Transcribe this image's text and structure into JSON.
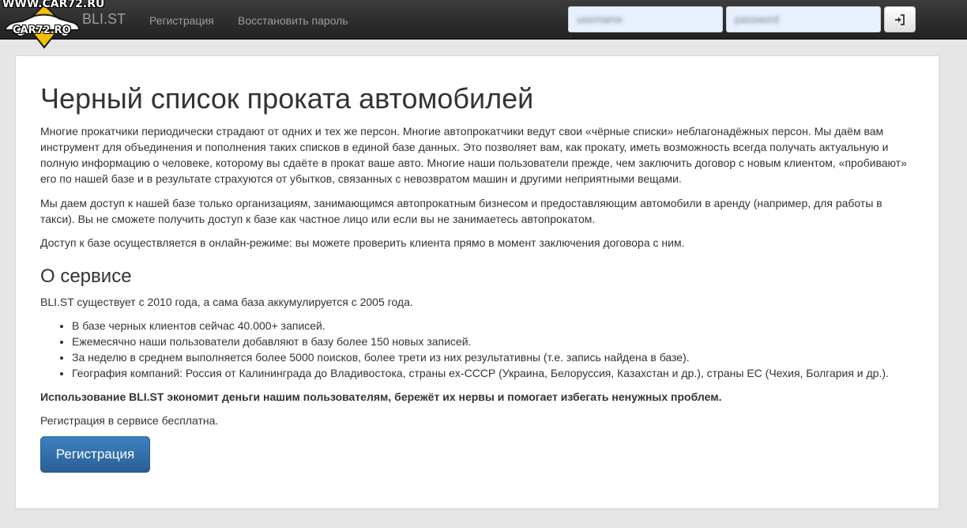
{
  "watermark": {
    "site": "WWW.CAR72.RU",
    "logo_text": "CAR72.RO"
  },
  "navbar": {
    "brand": "BLI.ST",
    "links": [
      {
        "label": "Регистрация"
      },
      {
        "label": "Восстановить пароль"
      }
    ],
    "login": {
      "email_value": "username",
      "password_value": "password",
      "submit_icon": "sign-in-icon"
    }
  },
  "main": {
    "title": "Черный список проката автомобилей",
    "intro_paragraphs": [
      "Многие прокатчики периодически страдают от одних и тех же персон. Многие автопрокатчики ведут свои «чёрные списки» неблагонадёжных персон. Мы даём вам инструмент для объединения и пополнения таких списков в единой базе данных. Это позволяет вам, как прокату, иметь возможность всегда получать актуальную и полную информацию о человеке, которому вы сдаёте в прокат ваше авто. Многие наши пользователи прежде, чем заключить договор с новым клиентом, «пробивают» его по нашей базе и в результате страхуются от убытков, связанных с невозвратом машин и другими неприятными вещами.",
      "Мы даем доступ к нашей базе только организациям, занимающимся автопрокатным бизнесом и предоставляющим автомобили в аренду (например, для работы в такси). Вы не сможете получить доступ к базе как частное лицо или если вы не занимаетесь автопрокатом.",
      "Доступ к базе осуществляется в онлайн-режиме: вы можете проверить клиента прямо в момент заключения договора с ним."
    ],
    "about": {
      "heading": "О сервисе",
      "intro": "BLI.ST существует с 2010 года, а сама база аккумулируется с 2005 года.",
      "features": [
        "В базе черных клиентов сейчас 40.000+ записей.",
        "Ежемесячно наши пользователи добавляют в базу более 150 новых записей.",
        "За неделю в среднем выполняется более 5000 поисков, более трети из них результативны (т.е. запись найдена в базе).",
        "География компаний: Россия от Калининграда до Владивостока, страны ex-СССР (Украина, Белоруссия, Казахстан и др.), страны ЕС (Чехия, Болгария и др.)."
      ],
      "highlight": "Использование BLI.ST экономит деньги нашим пользователям, бережёт их нервы и помогает избегать ненужных проблем.",
      "free_note": "Регистрация в сервисе бесплатна.",
      "register_button": "Регистрация"
    }
  },
  "colors": {
    "navbar_bg": "#222222",
    "nav_text": "#9d9d9d",
    "page_bg": "#e6e6e6",
    "primary": "#337ab7",
    "input_bg": "#e8f0fe"
  }
}
